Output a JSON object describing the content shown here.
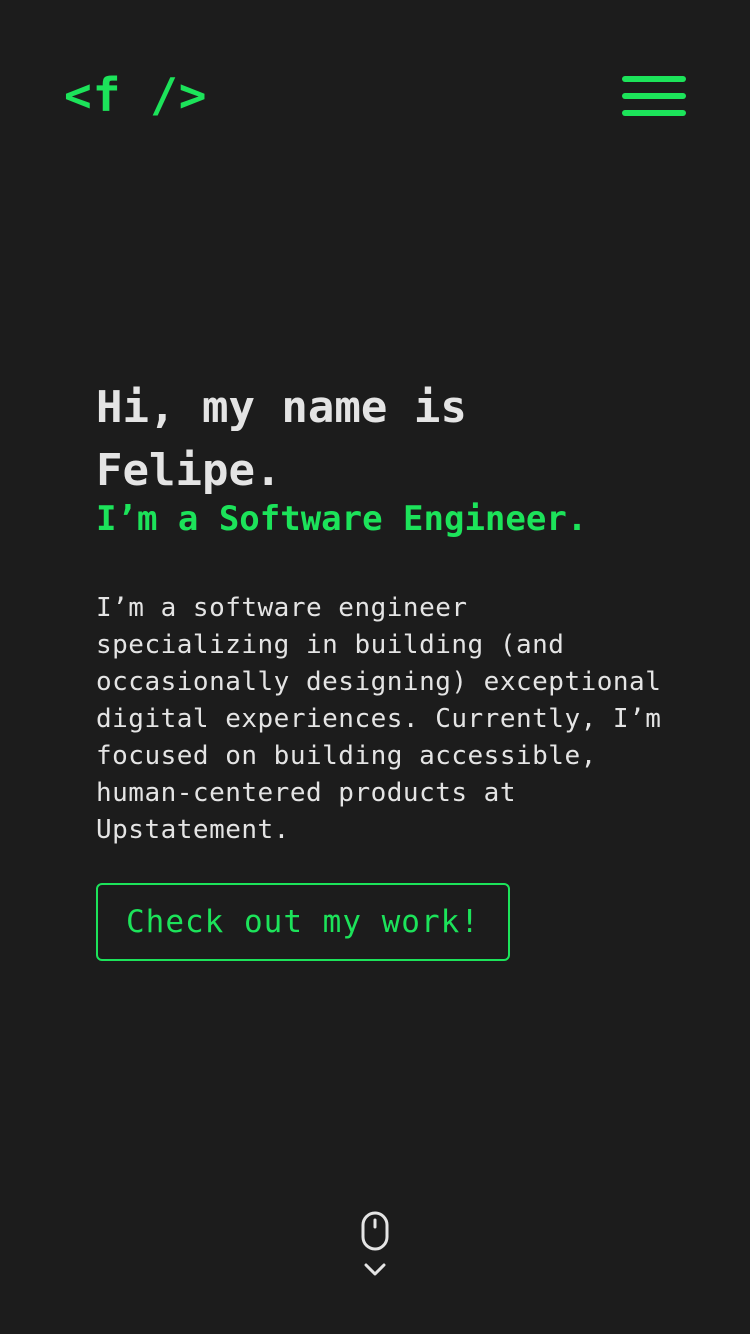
{
  "header": {
    "logo_text": "<f />",
    "menu_icon": "hamburger-menu-icon"
  },
  "hero": {
    "greeting": "Hi, my name is Felipe.",
    "role": "I’m a Software Engineer.",
    "bio": "I’m a software engineer specializing in building (and occasionally designing) exceptional digital experiences. Currently, I’m focused on building accessible, human-centered products at Upstatement.",
    "cta_label": "Check out my work!"
  },
  "scroll_indicator": {
    "icons": [
      "mouse-icon",
      "chevron-down-icon"
    ]
  },
  "colors": {
    "background": "#1c1c1c",
    "accent": "#1ce35a",
    "text": "#e4e4e4"
  }
}
